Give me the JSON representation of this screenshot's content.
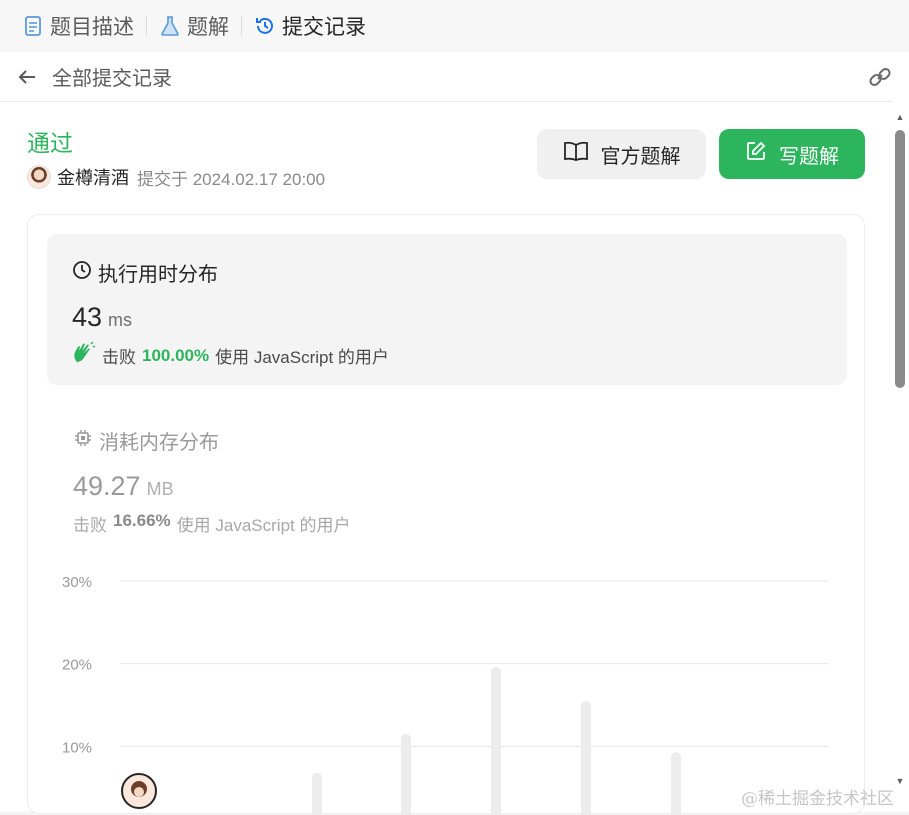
{
  "tabs": [
    {
      "label": "题目描述",
      "icon": "document-icon",
      "active": false
    },
    {
      "label": "题解",
      "icon": "flask-icon",
      "active": false
    },
    {
      "label": "提交记录",
      "icon": "history-icon",
      "active": true
    }
  ],
  "subheader": {
    "title": "全部提交记录"
  },
  "submission": {
    "status": "通过",
    "author": "金樽清酒",
    "submitted_text": "提交于 2024.02.17 20:00"
  },
  "buttons": {
    "official": "官方题解",
    "write": "写题解"
  },
  "runtime": {
    "title": "执行用时分布",
    "value": "43",
    "unit": "ms",
    "beat_prefix": "击败",
    "beat_pct": "100.00%",
    "beat_suffix": "使用 JavaScript 的用户"
  },
  "memory": {
    "title": "消耗内存分布",
    "value": "49.27",
    "unit": "MB",
    "beat_prefix": "击败",
    "beat_pct": "16.66%",
    "beat_suffix": "使用 JavaScript 的用户"
  },
  "chart_data": {
    "type": "bar",
    "title": "",
    "xlabel": "",
    "ylabel": "",
    "ylim": [
      0,
      30
    ],
    "yticks": [
      "30%",
      "20%",
      "10%"
    ],
    "grid": true,
    "values": [
      6.8,
      11.5,
      19.6,
      15.5,
      9.3
    ]
  },
  "colors": {
    "accent": "#2db55d",
    "bar": "#ececec"
  },
  "watermark": "@稀土掘金技术社区"
}
